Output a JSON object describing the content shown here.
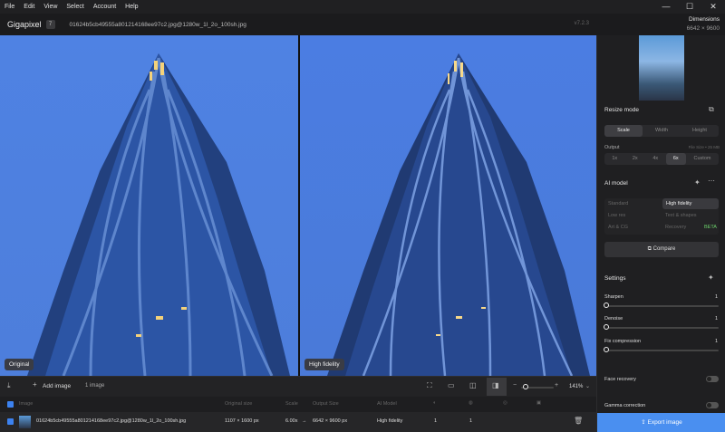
{
  "menu": [
    "File",
    "Edit",
    "View",
    "Select",
    "Account",
    "Help"
  ],
  "app": {
    "name": "Gigapixel",
    "badge": "7",
    "filename": "01624b5cb49555a801214168ee97c2.jpg@1280w_1l_2o_100sh.jpg",
    "version": "v7.2.3"
  },
  "dimensions": {
    "label": "Dimensions",
    "value": "6642 × 9600"
  },
  "panes": {
    "left_label": "Original",
    "right_label": "High fidelity"
  },
  "resize": {
    "title": "Resize mode",
    "tabs": [
      "Scale",
      "Width",
      "Height"
    ],
    "output_label": "Output",
    "output_hint": "File Size • 25 MB",
    "scales": [
      "1x",
      "2x",
      "4x",
      "6x",
      "Custom"
    ],
    "active_scale": "6x"
  },
  "ai": {
    "title": "AI model",
    "models": [
      "Standard",
      "High fidelity",
      "Low res",
      "Text & shapes",
      "Art & CG",
      "Recovery"
    ],
    "active": "High fidelity",
    "beta": "BETA",
    "compare": "Compare"
  },
  "settings": {
    "title": "Settings",
    "sliders": [
      {
        "label": "Sharpen",
        "value": "1"
      },
      {
        "label": "Denoise",
        "value": "1"
      },
      {
        "label": "Fix compression",
        "value": "1"
      }
    ]
  },
  "toggles": {
    "face": "Face recovery",
    "gamma": "Gamma correction"
  },
  "export": "Export image",
  "bottom": {
    "add": "Add image",
    "count": "1 image",
    "zoom": "141%"
  },
  "table": {
    "headers": [
      "Image",
      "Original size",
      "Scale",
      "Output Size",
      "AI Model"
    ],
    "row": {
      "name": "01624b5cb49555a801214168ee97c2.jpg@1280w_1l_2o_100sh.jpg",
      "orig": "1107 × 1600 px",
      "scale": "6.00x",
      "arrow": "→",
      "out": "6642 × 9600 px",
      "model": "High fidelity",
      "c1": "1",
      "c2": "1"
    }
  },
  "colors": {
    "accent": "#4a8ff0",
    "sky": "#4f82e3",
    "beta": "#6bd16b"
  }
}
